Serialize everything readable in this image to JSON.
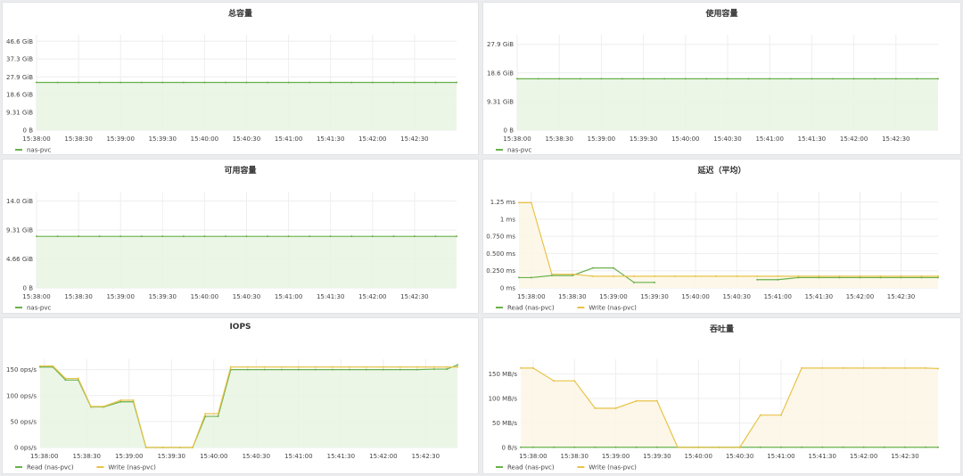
{
  "colors": {
    "read": "#6ab04c",
    "write": "#e8c349",
    "read_fill": "#e8f5e3",
    "write_fill": "#fbf6e4",
    "grid": "#eeeeee"
  },
  "chart_data": [
    {
      "id": "total",
      "type": "area",
      "title": "总容量",
      "x": [
        "15:38:00",
        "15:38:30",
        "15:39:00",
        "15:39:30",
        "15:40:00",
        "15:40:30",
        "15:41:00",
        "15:41:30",
        "15:42:00",
        "15:42:30"
      ],
      "xlim": [
        0,
        10
      ],
      "ylim": [
        0,
        50
      ],
      "yticks": [
        0,
        9.31,
        18.6,
        27.9,
        37.3,
        46.6
      ],
      "ytick_labels": [
        "0 B",
        "9.31 GiB",
        "18.6 GiB",
        "27.9 GiB",
        "37.3 GiB",
        "46.6 GiB"
      ],
      "series": [
        {
          "name": "nas-pvc",
          "color": "read",
          "fill": true,
          "points": [
            [
              0,
              25
            ],
            [
              0.5,
              25
            ],
            [
              1,
              25
            ],
            [
              1.5,
              25
            ],
            [
              2,
              25
            ],
            [
              2.5,
              25
            ],
            [
              3,
              25
            ],
            [
              3.5,
              25
            ],
            [
              4,
              25
            ],
            [
              4.5,
              25
            ],
            [
              5,
              25
            ],
            [
              5.5,
              25
            ],
            [
              6,
              25
            ],
            [
              6.5,
              25
            ],
            [
              7,
              25
            ],
            [
              7.5,
              25
            ],
            [
              8,
              25
            ],
            [
              8.5,
              25
            ],
            [
              9,
              25
            ],
            [
              9.5,
              25
            ],
            [
              10,
              25
            ]
          ]
        }
      ]
    },
    {
      "id": "used",
      "type": "area",
      "title": "使用容量",
      "x": [
        "15:38:00",
        "15:38:30",
        "15:39:00",
        "15:39:30",
        "15:40:00",
        "15:40:30",
        "15:41:00",
        "15:41:30",
        "15:42:00",
        "15:42:30"
      ],
      "xlim": [
        0,
        10
      ],
      "ylim": [
        0,
        31
      ],
      "yticks": [
        0,
        9.31,
        18.6,
        27.9
      ],
      "ytick_labels": [
        "0 B",
        "9.31 GiB",
        "18.6 GiB",
        "27.9 GiB"
      ],
      "series": [
        {
          "name": "nas-pvc",
          "color": "read",
          "fill": true,
          "points": [
            [
              0,
              16.7
            ],
            [
              0.5,
              16.7
            ],
            [
              1,
              16.7
            ],
            [
              1.5,
              16.7
            ],
            [
              2,
              16.7
            ],
            [
              2.5,
              16.7
            ],
            [
              3,
              16.7
            ],
            [
              3.5,
              16.7
            ],
            [
              4,
              16.7
            ],
            [
              4.5,
              16.7
            ],
            [
              5,
              16.7
            ],
            [
              5.5,
              16.7
            ],
            [
              6,
              16.7
            ],
            [
              6.5,
              16.7
            ],
            [
              7,
              16.7
            ],
            [
              7.5,
              16.7
            ],
            [
              8,
              16.7
            ],
            [
              8.5,
              16.7
            ],
            [
              9,
              16.7
            ],
            [
              9.5,
              16.7
            ],
            [
              10,
              16.7
            ]
          ]
        }
      ]
    },
    {
      "id": "available",
      "type": "area",
      "title": "可用容量",
      "x": [
        "15:38:00",
        "15:38:30",
        "15:39:00",
        "15:39:30",
        "15:40:00",
        "15:40:30",
        "15:41:00",
        "15:41:30",
        "15:42:00",
        "15:42:30"
      ],
      "xlim": [
        0,
        10
      ],
      "ylim": [
        0,
        15.5
      ],
      "yticks": [
        0,
        4.66,
        9.31,
        14.0
      ],
      "ytick_labels": [
        "0 B",
        "4.66 GiB",
        "9.31 GiB",
        "14.0 GiB"
      ],
      "series": [
        {
          "name": "nas-pvc",
          "color": "read",
          "fill": true,
          "points": [
            [
              0,
              8.3
            ],
            [
              0.5,
              8.3
            ],
            [
              1,
              8.3
            ],
            [
              1.5,
              8.3
            ],
            [
              2,
              8.3
            ],
            [
              2.5,
              8.3
            ],
            [
              3,
              8.3
            ],
            [
              3.5,
              8.3
            ],
            [
              4,
              8.3
            ],
            [
              4.5,
              8.3
            ],
            [
              5,
              8.3
            ],
            [
              5.5,
              8.3
            ],
            [
              6,
              8.3
            ],
            [
              6.5,
              8.3
            ],
            [
              7,
              8.3
            ],
            [
              7.5,
              8.3
            ],
            [
              8,
              8.3
            ],
            [
              8.5,
              8.3
            ],
            [
              9,
              8.3
            ],
            [
              9.5,
              8.3
            ],
            [
              10,
              8.3
            ]
          ]
        }
      ]
    },
    {
      "id": "latency",
      "type": "area",
      "title": "延迟（平均）",
      "x": [
        "15:38:00",
        "15:38:30",
        "15:39:00",
        "15:39:30",
        "15:40:00",
        "15:40:30",
        "15:41:00",
        "15:41:30",
        "15:42:00",
        "15:42:30"
      ],
      "xlim": [
        -0.3,
        9.9
      ],
      "ylim": [
        0,
        1.4
      ],
      "yticks": [
        0,
        0.25,
        0.5,
        0.75,
        1.0,
        1.25
      ],
      "ytick_labels": [
        "0 ms",
        "0.250 ms",
        "0.500 ms",
        "0.750 ms",
        "1 ms",
        "1.25 ms"
      ],
      "series": [
        {
          "name": "Read (nas-pvc)",
          "color": "read",
          "fill": false,
          "points": [
            [
              -0.3,
              0.15
            ],
            [
              0,
              0.15
            ],
            [
              0.5,
              0.18
            ],
            [
              1,
              0.18
            ],
            [
              1.5,
              0.29
            ],
            [
              2,
              0.29
            ],
            [
              2.5,
              0.08
            ],
            [
              3,
              0.08
            ],
            [
              null,
              null
            ],
            [
              5.5,
              0.12
            ],
            [
              6,
              0.12
            ],
            [
              6.5,
              0.15
            ],
            [
              7,
              0.15
            ],
            [
              7.5,
              0.15
            ],
            [
              8,
              0.15
            ],
            [
              8.5,
              0.15
            ],
            [
              9,
              0.15
            ],
            [
              9.5,
              0.15
            ],
            [
              9.9,
              0.15
            ]
          ]
        },
        {
          "name": "Write (nas-pvc)",
          "color": "write",
          "fill": true,
          "points": [
            [
              -0.3,
              1.24
            ],
            [
              0,
              1.24
            ],
            [
              0.5,
              0.2
            ],
            [
              1,
              0.2
            ],
            [
              1.5,
              0.17
            ],
            [
              2,
              0.17
            ],
            [
              2.5,
              0.17
            ],
            [
              3,
              0.17
            ],
            [
              3.5,
              0.17
            ],
            [
              4,
              0.17
            ],
            [
              4.5,
              0.17
            ],
            [
              5,
              0.17
            ],
            [
              5.5,
              0.17
            ],
            [
              6,
              0.17
            ],
            [
              6.5,
              0.17
            ],
            [
              7,
              0.17
            ],
            [
              7.5,
              0.17
            ],
            [
              8,
              0.17
            ],
            [
              8.5,
              0.17
            ],
            [
              9,
              0.17
            ],
            [
              9.5,
              0.17
            ],
            [
              9.9,
              0.17
            ]
          ]
        }
      ]
    },
    {
      "id": "iops",
      "type": "area",
      "title": "IOPS",
      "x": [
        "15:38:00",
        "15:38:30",
        "15:39:00",
        "15:39:30",
        "15:40:00",
        "15:40:30",
        "15:41:00",
        "15:41:30",
        "15:42:00",
        "15:42:30"
      ],
      "xlim": [
        -0.1,
        9.75
      ],
      "ylim": [
        0,
        170
      ],
      "yticks": [
        0,
        50,
        100,
        150
      ],
      "ytick_labels": [
        "0 ops/s",
        "50 ops/s",
        "100 ops/s",
        "150 ops/s"
      ],
      "series": [
        {
          "name": "Read (nas-pvc)",
          "color": "read",
          "fill": true,
          "points": [
            [
              -0.1,
              155
            ],
            [
              0.2,
              155
            ],
            [
              0.5,
              130
            ],
            [
              0.8,
              130
            ],
            [
              1.1,
              78
            ],
            [
              1.4,
              78
            ],
            [
              1.8,
              88
            ],
            [
              2.1,
              88
            ],
            [
              2.4,
              0
            ],
            [
              2.8,
              0
            ],
            [
              3.2,
              0
            ],
            [
              3.5,
              0
            ],
            [
              3.8,
              60
            ],
            [
              4.1,
              60
            ],
            [
              4.4,
              150
            ],
            [
              4.8,
              150
            ],
            [
              5.2,
              150
            ],
            [
              5.6,
              150
            ],
            [
              6.0,
              150
            ],
            [
              6.4,
              150
            ],
            [
              6.8,
              150
            ],
            [
              7.2,
              150
            ],
            [
              7.6,
              150
            ],
            [
              8.0,
              150
            ],
            [
              8.4,
              150
            ],
            [
              8.8,
              150
            ],
            [
              9.2,
              151
            ],
            [
              9.5,
              151
            ],
            [
              9.75,
              159
            ]
          ]
        },
        {
          "name": "Write (nas-pvc)",
          "color": "write",
          "fill": false,
          "points": [
            [
              -0.1,
              157
            ],
            [
              0.2,
              157
            ],
            [
              0.5,
              133
            ],
            [
              0.8,
              133
            ],
            [
              1.1,
              79
            ],
            [
              1.4,
              79
            ],
            [
              1.8,
              91
            ],
            [
              2.1,
              91
            ],
            [
              2.4,
              0
            ],
            [
              2.8,
              0
            ],
            [
              3.2,
              0
            ],
            [
              3.5,
              0
            ],
            [
              3.8,
              65
            ],
            [
              4.1,
              65
            ],
            [
              4.4,
              155
            ],
            [
              4.8,
              155
            ],
            [
              5.2,
              155
            ],
            [
              5.6,
              155
            ],
            [
              6.0,
              155
            ],
            [
              6.4,
              155
            ],
            [
              6.8,
              155
            ],
            [
              7.2,
              155
            ],
            [
              7.6,
              155
            ],
            [
              8.0,
              155
            ],
            [
              8.4,
              155
            ],
            [
              8.8,
              155
            ],
            [
              9.2,
              155
            ],
            [
              9.5,
              155
            ],
            [
              9.75,
              155
            ]
          ]
        }
      ]
    },
    {
      "id": "throughput",
      "type": "area",
      "title": "吞吐量",
      "x": [
        "15:38:00",
        "15:38:30",
        "15:39:00",
        "15:39:30",
        "15:40:00",
        "15:40:30",
        "15:41:00",
        "15:41:30",
        "15:42:00",
        "15:42:30"
      ],
      "xlim": [
        -0.3,
        9.8
      ],
      "ylim": [
        0,
        180
      ],
      "yticks": [
        0,
        50,
        100,
        150
      ],
      "ytick_labels": [
        "0 B/s",
        "50 MB/s",
        "100 MB/s",
        "150 MB/s"
      ],
      "series": [
        {
          "name": "Read (nas-pvc)",
          "color": "read",
          "fill": false,
          "points": [
            [
              -0.3,
              0.5
            ],
            [
              0,
              0.5
            ],
            [
              0.5,
              0.5
            ],
            [
              1,
              0.5
            ],
            [
              1.5,
              0.5
            ],
            [
              2,
              0.5
            ],
            [
              2.5,
              0.5
            ],
            [
              3,
              0.5
            ],
            [
              3.5,
              0.5
            ],
            [
              4,
              0.5
            ],
            [
              4.5,
              0.5
            ],
            [
              5,
              0.5
            ],
            [
              5.5,
              0.5
            ],
            [
              6,
              0.5
            ],
            [
              6.5,
              0.5
            ],
            [
              7,
              0.5
            ],
            [
              7.5,
              0.5
            ],
            [
              8,
              0.5
            ],
            [
              8.5,
              0.5
            ],
            [
              9,
              0.5
            ],
            [
              9.5,
              0.5
            ],
            [
              9.8,
              0.5
            ]
          ]
        },
        {
          "name": "Write (nas-pvc)",
          "color": "write",
          "fill": true,
          "points": [
            [
              -0.3,
              162
            ],
            [
              0,
              162
            ],
            [
              0.5,
              136
            ],
            [
              1,
              136
            ],
            [
              1.5,
              80
            ],
            [
              2,
              80
            ],
            [
              2.5,
              95
            ],
            [
              3,
              95
            ],
            [
              3.5,
              0
            ],
            [
              4,
              0
            ],
            [
              4.5,
              0
            ],
            [
              5,
              0
            ],
            [
              5.5,
              66
            ],
            [
              6,
              66
            ],
            [
              6.5,
              162
            ],
            [
              7,
              162
            ],
            [
              7.5,
              162
            ],
            [
              8,
              162
            ],
            [
              8.5,
              162
            ],
            [
              9,
              162
            ],
            [
              9.5,
              162
            ],
            [
              9.8,
              161
            ]
          ]
        }
      ]
    }
  ]
}
